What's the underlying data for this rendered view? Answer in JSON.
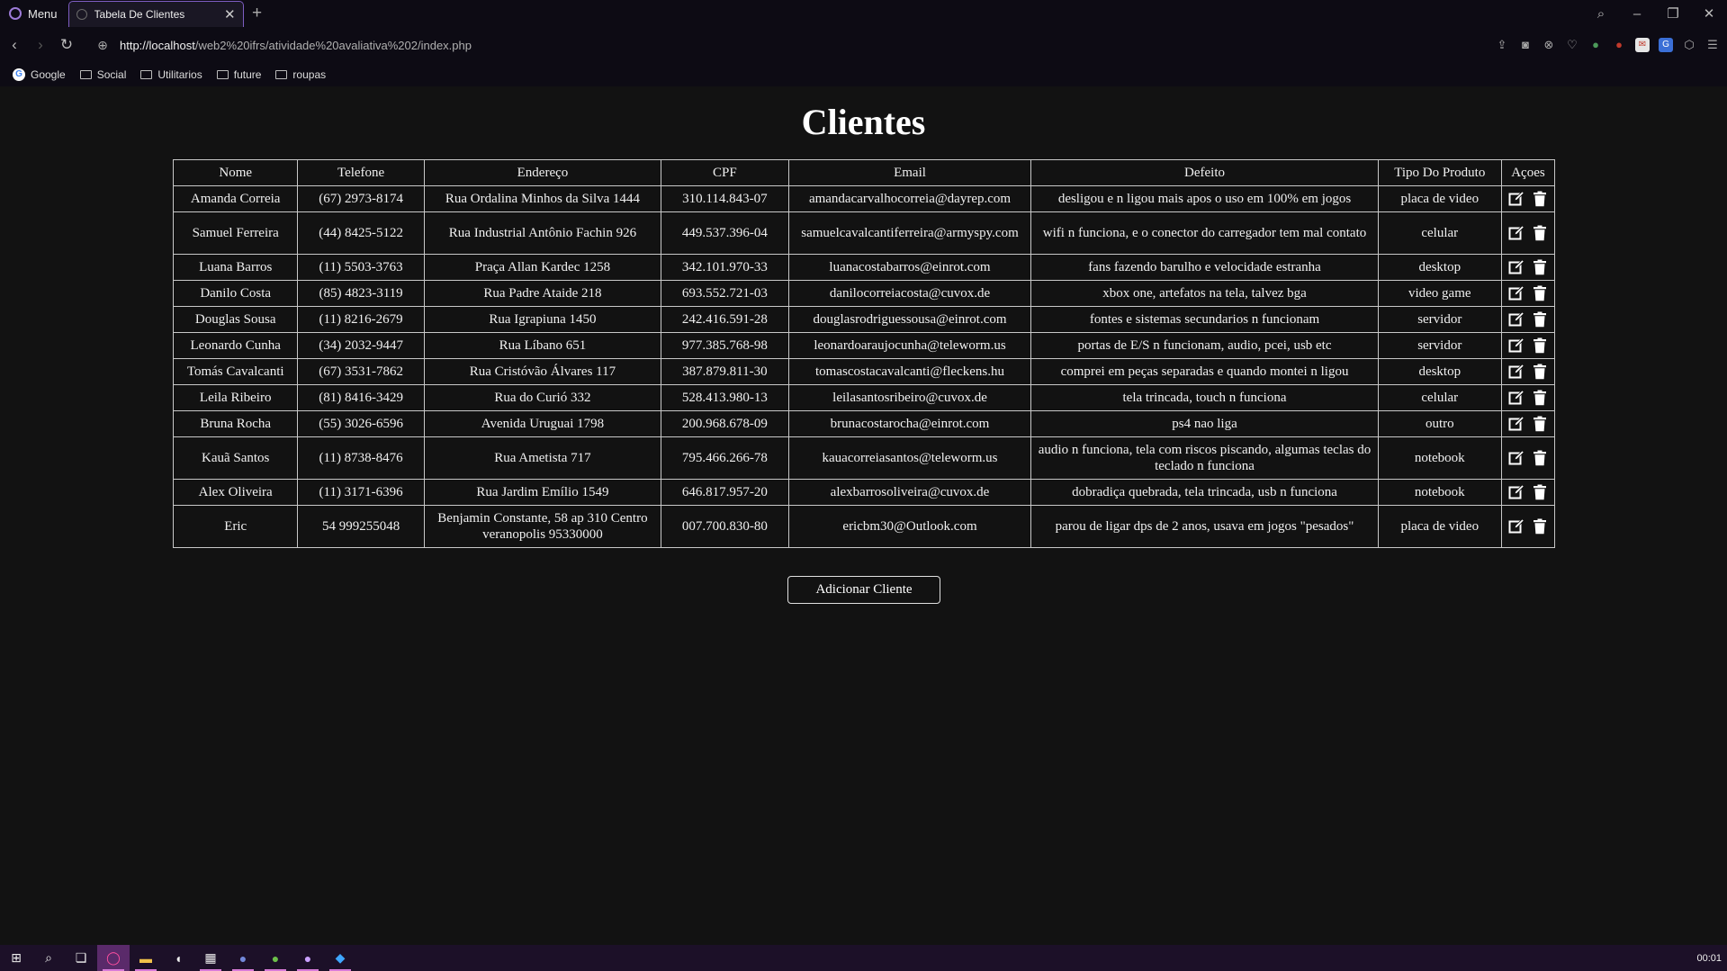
{
  "browser": {
    "menu_label": "Menu",
    "tab_title": "Tabela De Clientes",
    "url_host": "http://localhost",
    "url_path": "/web2%20ifrs/atividade%20avaliativa%202/index.php",
    "bookmarks": [
      "Google",
      "Social",
      "Utilitarios",
      "future",
      "roupas"
    ]
  },
  "page": {
    "title": "Clientes",
    "add_button": "Adicionar Cliente"
  },
  "table": {
    "headers": [
      "Nome",
      "Telefone",
      "Endereço",
      "CPF",
      "Email",
      "Defeito",
      "Tipo Do Produto",
      "Açoes"
    ],
    "rows": [
      [
        "Amanda Correia",
        "(67) 2973-8174",
        "Rua Ordalina Minhos da Silva 1444",
        "310.114.843-07",
        "amandacarvalhocorreia@dayrep.com",
        "desligou e n ligou mais apos o uso em 100% em jogos",
        "placa de video"
      ],
      [
        "Samuel Ferreira",
        "(44) 8425-5122",
        "Rua Industrial Antônio Fachin 926",
        "449.537.396-04",
        "samuelcavalcantiferreira@armyspy.com",
        "wifi n funciona, e o conector do carregador tem mal contato",
        "celular"
      ],
      [
        "Luana Barros",
        "(11) 5503-3763",
        "Praça Allan Kardec 1258",
        "342.101.970-33",
        "luanacostabarros@einrot.com",
        "fans fazendo barulho e velocidade estranha",
        "desktop"
      ],
      [
        "Danilo Costa",
        "(85) 4823-3119",
        "Rua Padre Ataide 218",
        "693.552.721-03",
        "danilocorreiacosta@cuvox.de",
        "xbox one, artefatos na tela, talvez bga",
        "video game"
      ],
      [
        "Douglas Sousa",
        "(11) 8216-2679",
        "Rua Igrapiuna 1450",
        "242.416.591-28",
        "douglasrodriguessousa@einrot.com",
        "fontes e sistemas secundarios n funcionam",
        "servidor"
      ],
      [
        "Leonardo Cunha",
        "(34) 2032-9447",
        "Rua Líbano 651",
        "977.385.768-98",
        "leonardoaraujocunha@teleworm.us",
        "portas de E/S n funcionam, audio, pcei, usb etc",
        "servidor"
      ],
      [
        "Tomás Cavalcanti",
        "(67) 3531-7862",
        "Rua Cristóvão Álvares 117",
        "387.879.811-30",
        "tomascostacavalcanti@fleckens.hu",
        "comprei em peças separadas e quando montei n ligou",
        "desktop"
      ],
      [
        "Leila Ribeiro",
        "(81) 8416-3429",
        "Rua do Curió 332",
        "528.413.980-13",
        "leilasantosribeiro@cuvox.de",
        "tela trincada, touch n funciona",
        "celular"
      ],
      [
        "Bruna Rocha",
        "(55) 3026-6596",
        "Avenida Uruguai 1798",
        "200.968.678-09",
        "brunacostarocha@einrot.com",
        "ps4 nao liga",
        "outro"
      ],
      [
        "Kauã Santos",
        "(11) 8738-8476",
        "Rua Ametista 717",
        "795.466.266-78",
        "kauacorreiasantos@teleworm.us",
        "audio n funciona, tela com riscos piscando, algumas teclas do teclado n funciona",
        "notebook"
      ],
      [
        "Alex Oliveira",
        "(11) 3171-6396",
        "Rua Jardim Emílio 1549",
        "646.817.957-20",
        "alexbarrosoliveira@cuvox.de",
        "dobradiça quebrada, tela trincada, usb n funciona",
        "notebook"
      ],
      [
        "Eric",
        "54 999255048",
        "Benjamin Constante, 58 ap 310 Centro veranopolis 95330000",
        "007.700.830-80",
        "ericbm30@Outlook.com",
        "parou de ligar dps de 2 anos, usava em jogos \"pesados\"",
        "placa de video"
      ]
    ]
  },
  "taskbar": {
    "clock": "00:01"
  }
}
